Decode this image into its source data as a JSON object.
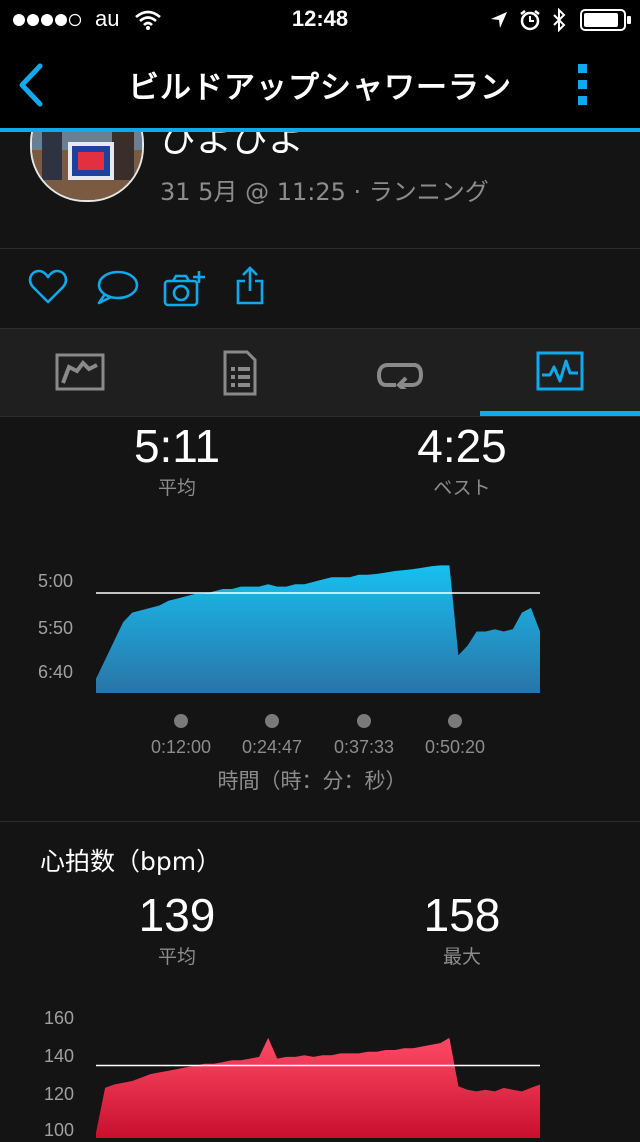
{
  "status_bar": {
    "carrier": "au",
    "time": "12:48"
  },
  "nav": {
    "title": "ビルドアップシャワーラン"
  },
  "activity": {
    "user_name": "ぴよぴよ",
    "meta": "31 5月 @ 11:25 · ランニング"
  },
  "pace": {
    "average_value": "5:11",
    "average_label": "平均",
    "best_value": "4:25",
    "best_label": "ベスト",
    "y_ticks": [
      "5:00",
      "5:50",
      "6:40"
    ],
    "x_ticks": [
      "0:12:00",
      "0:24:47",
      "0:37:33",
      "0:50:20"
    ],
    "x_axis_label": "時間（時：分：秒）",
    "color": "#1ab6e8"
  },
  "heart_rate": {
    "title": "心拍数（bpm）",
    "average_value": "139",
    "average_label": "平均",
    "max_value": "158",
    "max_label": "最大",
    "y_ticks": [
      "160",
      "140",
      "120",
      "100"
    ],
    "color": "#e8294a"
  },
  "chart_data": [
    {
      "type": "area",
      "title": "",
      "xlabel": "時間（時：分：秒）",
      "ylabel": "",
      "x_tick_labels": [
        "0:12:00",
        "0:24:47",
        "0:37:33",
        "0:50:20"
      ],
      "y_tick_labels": [
        "5:00",
        "5:50",
        "6:40"
      ],
      "reference_line": "5:11",
      "series": [
        {
          "values": [
            7.0,
            6.6,
            6.2,
            5.8,
            5.6,
            5.55,
            5.5,
            5.45,
            5.35,
            5.3,
            5.25,
            5.2,
            5.2,
            5.15,
            5.1,
            5.1,
            5.05,
            5.05,
            5.05,
            5.0,
            5.05,
            5.05,
            5.0,
            5.0,
            4.95,
            4.9,
            4.85,
            4.85,
            4.85,
            4.8,
            4.8,
            4.78,
            4.75,
            4.72,
            4.7,
            4.68,
            4.65,
            4.62,
            4.6,
            4.6,
            6.5,
            6.3,
            6.0,
            6.0,
            5.95,
            6.0,
            5.95,
            5.6,
            5.5,
            6.0
          ]
        }
      ]
    },
    {
      "type": "area",
      "title": "心拍数（bpm）",
      "xlabel": "",
      "ylabel": "",
      "ylim": [
        100,
        160
      ],
      "reference_line": 139,
      "series": [
        {
          "values": [
            100,
            126,
            128,
            129,
            130,
            132,
            134,
            135,
            136,
            137,
            138,
            139,
            140,
            140,
            141,
            142,
            142,
            143,
            144,
            155,
            143,
            144,
            144,
            145,
            144,
            145,
            145,
            146,
            146,
            146,
            147,
            147,
            148,
            148,
            149,
            149,
            150,
            151,
            152,
            155,
            127,
            125,
            124,
            125,
            124,
            126,
            125,
            124,
            126,
            128
          ]
        }
      ]
    }
  ]
}
